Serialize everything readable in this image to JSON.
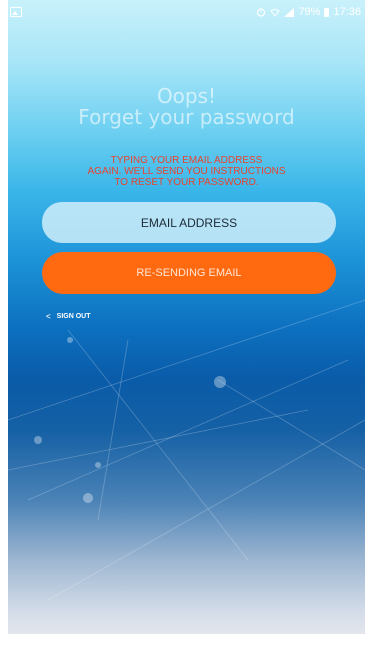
{
  "status_bar": {
    "battery_percent": "79%",
    "time": "17:36",
    "icons": [
      "gallery-icon",
      "alarm-icon",
      "wifi-icon",
      "signal-icon",
      "battery-icon"
    ]
  },
  "title": {
    "line1": "Oops!",
    "line2": "Forget your password"
  },
  "message": {
    "line1": "TYPING YOUR EMAIL ADDRESS",
    "line2": "AGAIN. WE'LL SEND YOU INSTRUCTIONS",
    "line3": "TO RESET YOUR PASSWORD."
  },
  "email_field": {
    "placeholder": "EMAIL ADDRESS",
    "value": ""
  },
  "resend_button": {
    "label": "RE-SENDING EMAIL"
  },
  "sign_out": {
    "chevron": "<",
    "label": "SIGN OUT"
  },
  "colors": {
    "accent_orange": "#ff6a10",
    "message_red": "#e8442f",
    "field_background": "#d6f0fb",
    "background_blue": "#0c6fbf"
  }
}
